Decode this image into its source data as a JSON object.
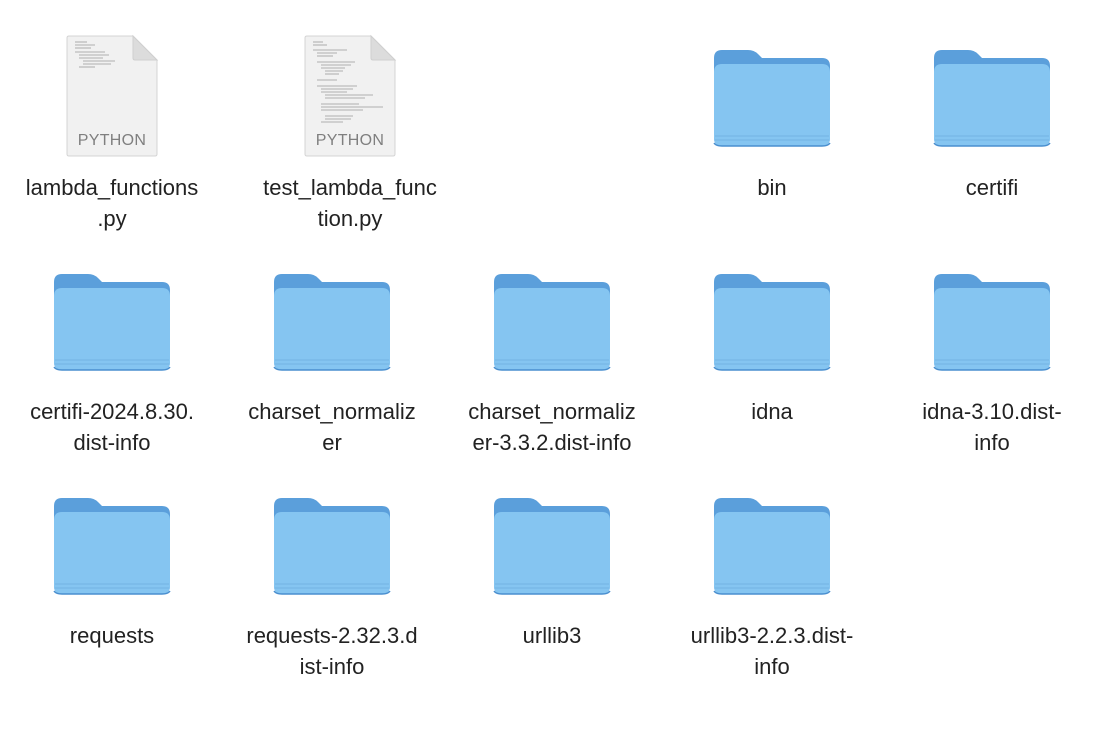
{
  "window": {
    "view_mode": "icon-view"
  },
  "colors": {
    "folder_front": "#85c5f1",
    "folder_back": "#5b9fdb",
    "folder_edge": "#4a8fcf",
    "doc_page": "#f1f1f1",
    "doc_fold": "#d9d9d9",
    "label_text": "#222222"
  },
  "files": [
    {
      "name": "lambda_functions\n.py",
      "kind": "python",
      "badge": "PYTHON",
      "icon": "python-file-icon"
    },
    {
      "name": "test_lambda_func\ntion.py",
      "kind": "python",
      "badge": "PYTHON",
      "icon": "python-file-icon"
    },
    {
      "name": "bin",
      "kind": "folder",
      "icon": "folder-icon"
    },
    {
      "name": "certifi",
      "kind": "folder",
      "icon": "folder-icon"
    },
    {
      "name": "certifi-2024.8.30.\ndist-info",
      "kind": "folder",
      "icon": "folder-icon"
    },
    {
      "name": "charset_normaliz\ner",
      "kind": "folder",
      "icon": "folder-icon"
    },
    {
      "name": "charset_normaliz\ner-3.3.2.dist-info",
      "kind": "folder",
      "icon": "folder-icon"
    },
    {
      "name": "idna",
      "kind": "folder",
      "icon": "folder-icon"
    },
    {
      "name": "idna-3.10.dist-\ninfo",
      "kind": "folder",
      "icon": "folder-icon"
    },
    {
      "name": "requests",
      "kind": "folder",
      "icon": "folder-icon"
    },
    {
      "name": "requests-2.32.3.d\nist-info",
      "kind": "folder",
      "icon": "folder-icon"
    },
    {
      "name": "urllib3",
      "kind": "folder",
      "icon": "folder-icon"
    },
    {
      "name": "urllib3-2.2.3.dist-\ninfo",
      "kind": "folder",
      "icon": "folder-icon"
    }
  ]
}
